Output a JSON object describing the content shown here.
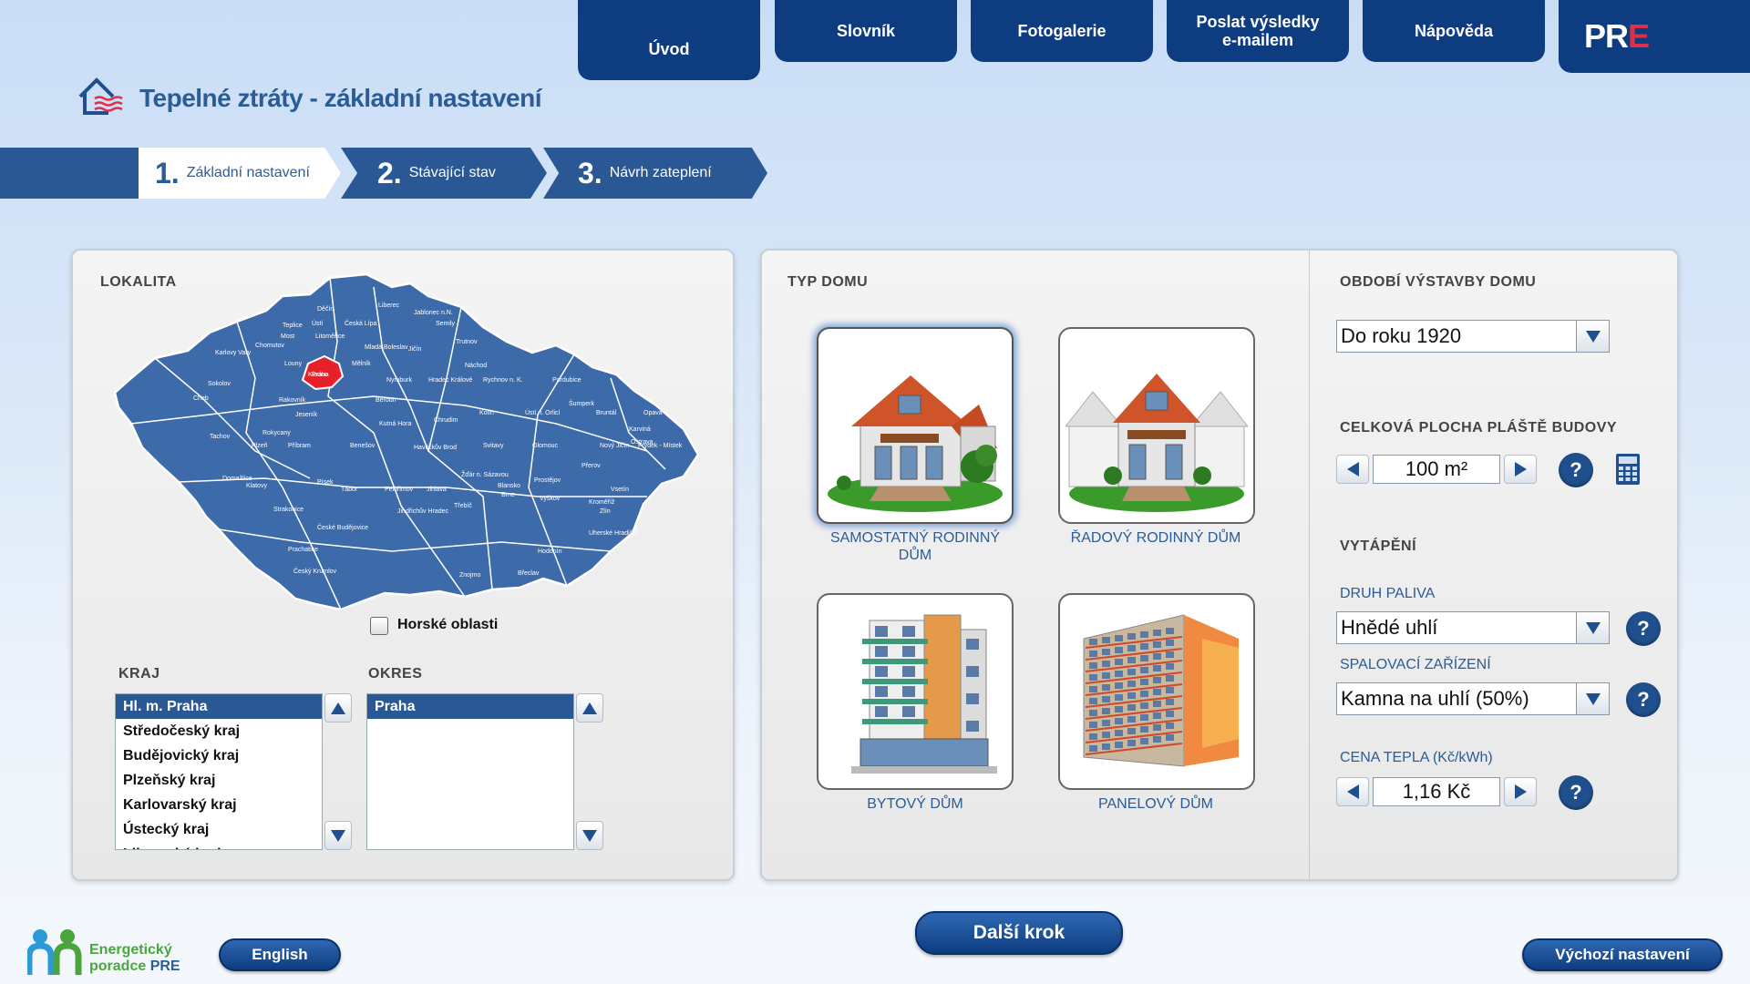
{
  "nav": {
    "tabs": [
      {
        "label": "Úvod",
        "active": true
      },
      {
        "label": "Slovník",
        "active": false
      },
      {
        "label": "Fotogalerie",
        "active": false
      },
      {
        "label_line1": "Poslat výsledky",
        "label_line2": "e-mailem",
        "active": false
      },
      {
        "label": "Nápověda",
        "active": false
      }
    ],
    "logo_main": "PR",
    "logo_accent": "E"
  },
  "page": {
    "title": "Tepelné ztráty - základní nastavení"
  },
  "steps": [
    {
      "num": "1.",
      "label": "Základní nastavení",
      "active": true
    },
    {
      "num": "2.",
      "label": "Stávající stav",
      "active": false
    },
    {
      "num": "3.",
      "label": "Návrh zateplení",
      "active": false
    }
  ],
  "lokalita": {
    "title": "LOKALITA",
    "selected_region_label": "Praha",
    "map_labels": [
      "Liberec",
      "Děčín",
      "Jablonec n.N.",
      "Ústí",
      "Česká Lípa",
      "Semily",
      "Teplice",
      "Most",
      "Litoměřice",
      "Trutnov",
      "Chomutov",
      "Mladá Boleslav",
      "Jičín",
      "Náchod",
      "Karlovy Vary",
      "Louny",
      "Mělník",
      "Hradec Králové",
      "Sokolov",
      "Kladno",
      "Nymburk",
      "Rychnov n. K.",
      "Cheb",
      "Rakovník",
      "Pardubice",
      "Jeseník",
      "Beroun",
      "Kolín",
      "Ústí n. Orlicí",
      "Šumperk",
      "Bruntál",
      "Opava",
      "Karviná",
      "Rokycany",
      "Kutná Hora",
      "Chrudim",
      "Ostrava",
      "Tachov",
      "Plzeň",
      "Příbram",
      "Benešov",
      "Havlíčkův Brod",
      "Svitavy",
      "Olomouc",
      "Nový Jičín",
      "Frýdek - Místek",
      "Domažlice",
      "Písek",
      "Tábor",
      "Pelhřimov",
      "Jihlava",
      "Žďár n. Sázavou",
      "Blansko",
      "Prostějov",
      "Přerov",
      "Vsetín",
      "Klatovy",
      "Strakonice",
      "Jindřichův Hradec",
      "Třebíč",
      "Brno",
      "Vyškov",
      "Kroměříž",
      "Zlín",
      "Prachatice",
      "České Budějovice",
      "Uherské Hradiště",
      "Hodonín",
      "Český Krumlov",
      "Znojmo",
      "Břeclav"
    ],
    "horske_oblasti_label": "Horské oblasti",
    "horske_oblasti_checked": false,
    "kraj_title": "KRAJ",
    "kraj_items": [
      "Hl. m. Praha",
      "Středočeský kraj",
      "Budějovický kraj",
      "Plzeňský kraj",
      "Karlovarský kraj",
      "Ústecký kraj",
      "Liberecký kraj"
    ],
    "okres_title": "OKRES",
    "okres_items": [
      "Praha"
    ]
  },
  "typ_domu": {
    "title": "TYP DOMU",
    "houses": [
      {
        "label_line1": "SAMOSTATNÝ RODINNÝ",
        "label_line2": "DŮM",
        "selected": true
      },
      {
        "label_line1": "ŘADOVÝ RODINNÝ DŮM",
        "label_line2": "",
        "selected": false
      },
      {
        "label_line1": "BYTOVÝ DŮM",
        "label_line2": "",
        "selected": false
      },
      {
        "label_line1": "PANELOVÝ DŮM",
        "label_line2": "",
        "selected": false
      }
    ]
  },
  "settings": {
    "obdobi_title": "OBDOBÍ VÝSTAVBY DOMU",
    "obdobi_value": "Do roku 1920",
    "plocha_title": "CELKOVÁ PLOCHA PLÁŠTĚ BUDOVY",
    "plocha_value": "100 m²",
    "vytapeni_title": "VYTÁPĚNÍ",
    "druh_paliva_label": "DRUH PALIVA",
    "druh_paliva_value": "Hnědé uhlí",
    "spalovaci_label": "SPALOVACÍ ZAŘÍZENÍ",
    "spalovaci_value": "Kamna na uhlí (50%)",
    "cena_label": "CENA TEPLA (Kč/kWh)",
    "cena_value": "1,16 Kč",
    "help_symbol": "?"
  },
  "footer": {
    "logo_line1": "Energetický",
    "logo_line2a": "poradce",
    "logo_line2b": "PRE",
    "english_button": "English",
    "next_button": "Další krok",
    "reset_button": "Výchozí nastavení"
  },
  "colors": {
    "nav_blue": "#0d3d80",
    "accent_red": "#e03049",
    "title_blue": "#2b5c96",
    "map_blue": "#3d6aa8",
    "map_selected": "#e8202a"
  },
  "icons": [
    "home-heat-icon",
    "calculator-icon",
    "help-icon",
    "arrow-up-icon",
    "arrow-down-icon",
    "arrow-left-icon",
    "arrow-right-icon",
    "dropdown-arrow-icon"
  ]
}
